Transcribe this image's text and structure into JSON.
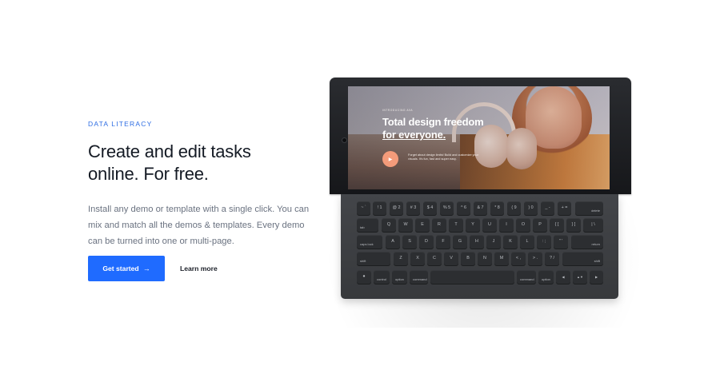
{
  "hero": {
    "eyebrow": "DATA LITERACY",
    "headline_line1": "Create and edit tasks",
    "headline_line2": "online. For free.",
    "description": "Install any demo or template with a single click. You can mix and match all the demos & templates. Every demo can be turned into one or multi-page.",
    "primary_button": "Get started",
    "primary_button_icon": "arrow-right-icon",
    "secondary_link": "Learn more"
  },
  "colors": {
    "accent": "#1f6bff",
    "eyebrow": "#2f6ee3",
    "headline": "#141a24",
    "body_text": "#6a7280"
  },
  "device_screen": {
    "kicker": "INTRODUCING AVA",
    "title_line1": "Total design freedom",
    "title_line2": "for everyone.",
    "body": "Forget about design limits! Build and customize your visuals. It's fun, fast and super easy.",
    "play_icon": "play-icon"
  },
  "keyboard": {
    "row1": [
      "~ `",
      "! 1",
      "@ 2",
      "# 3",
      "$ 4",
      "% 5",
      "^ 6",
      "& 7",
      "* 8",
      "( 9",
      ") 0",
      "_ -",
      "+ =",
      "delete"
    ],
    "row2": [
      "tab",
      "Q",
      "W",
      "E",
      "R",
      "T",
      "Y",
      "U",
      "I",
      "O",
      "P",
      "{ [",
      "} ]",
      "| \\"
    ],
    "row3": [
      "caps lock",
      "A",
      "S",
      "D",
      "F",
      "G",
      "H",
      "J",
      "K",
      "L",
      ": ;",
      "\" '",
      "return"
    ],
    "row4": [
      "shift",
      "Z",
      "X",
      "C",
      "V",
      "B",
      "N",
      "M",
      "< ,",
      "> .",
      "? /",
      "shift"
    ],
    "row5": [
      "globe",
      "control",
      "option",
      "command",
      "",
      "command",
      "option",
      "◀",
      "▲▼",
      "▶"
    ]
  }
}
